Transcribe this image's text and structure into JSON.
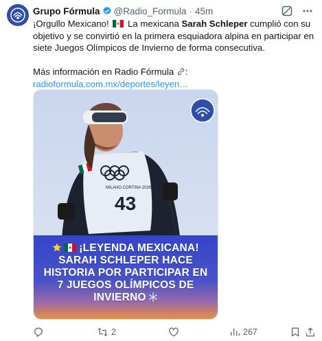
{
  "account": {
    "name": "Grupo Fórmula",
    "handle": "@Radio_Formula",
    "separator": "·",
    "time": "45m"
  },
  "post": {
    "part1": "¡Orgullo Mexicano!",
    "part2": "La mexicana",
    "bold_name": "Sarah Schleper",
    "part3": "cumplió con su objetivo y se convirtió en la primera esquiadora alpina en participar en siete Juegos Olímpicos de Invierno de forma consecutiva.",
    "more_info": "Más información en Radio Fórmula",
    "link_text": "radioformula.com.mx/deportes/leyen…"
  },
  "media": {
    "overlay_lines": [
      "¡LEYENDA MEXICANA!",
      "SARAH SCHLEPER HACE",
      "HISTORIA POR PARTICIPAR EN",
      "7 JUEGOS OLÍMPICOS DE",
      "INVIERNO"
    ],
    "bib_number": "43",
    "bib_event": "MILANO CORTINA 2026"
  },
  "actions": {
    "reposts": "2",
    "views": "267"
  },
  "colors": {
    "link": "#1d9bf0",
    "muted": "#536471",
    "verified": "#1d9bf0",
    "banner_blue": "#2d3fc4",
    "banner_orange": "#e8903a"
  },
  "icons": [
    "avatar-logo",
    "verified-badge-icon",
    "grok-icon",
    "more-icon",
    "mexico-flag-icon",
    "link-icon",
    "star-icon",
    "snowflake-icon",
    "reply-icon",
    "repost-icon",
    "like-icon",
    "views-icon",
    "bookmark-icon",
    "share-icon"
  ]
}
